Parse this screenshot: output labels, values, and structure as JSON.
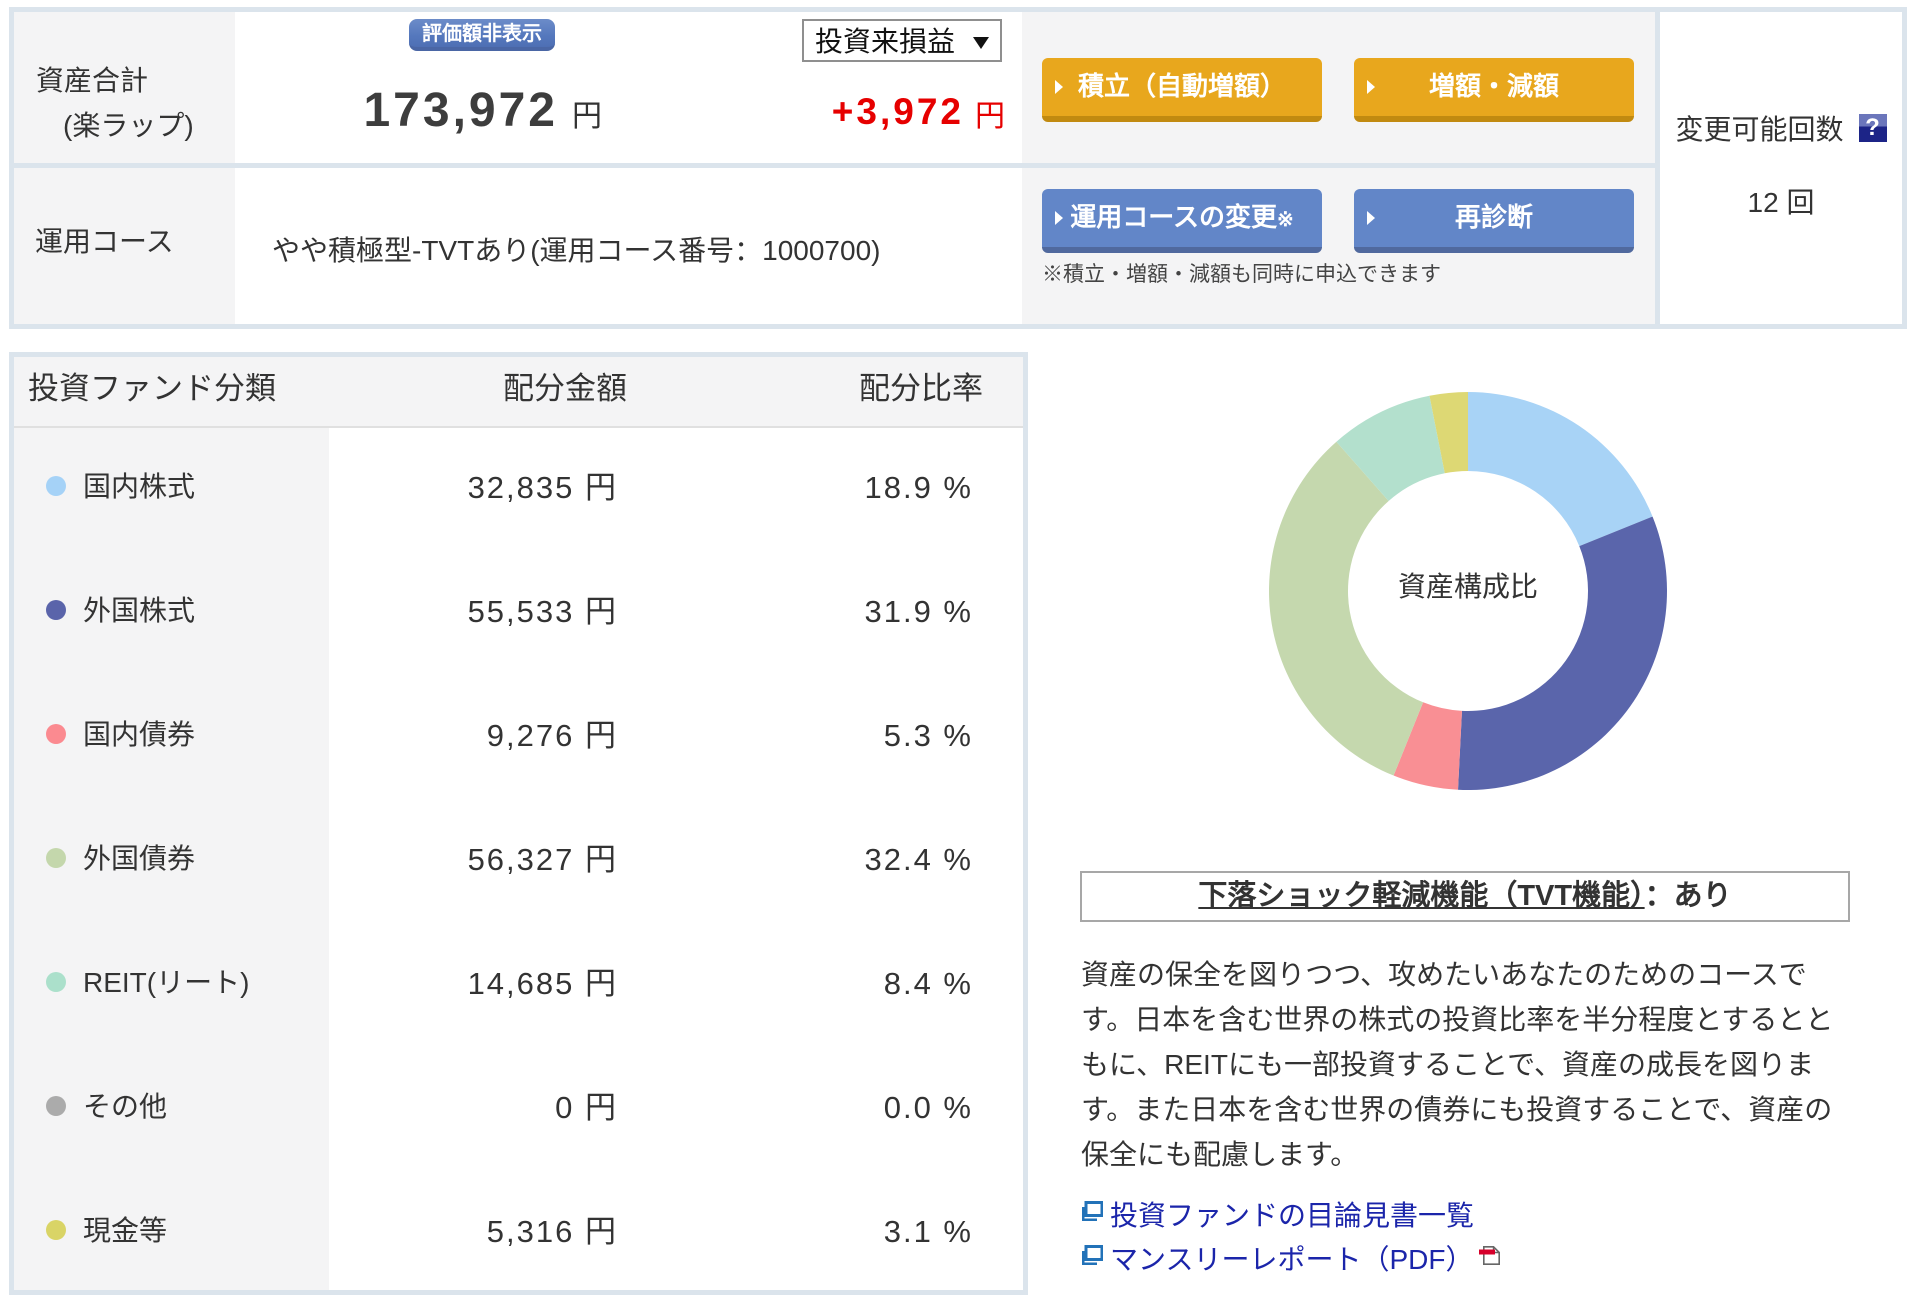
{
  "summary": {
    "asset_total_label_line1": "資産合計",
    "asset_total_label_line2": "(楽ラップ)",
    "hide_value_button": "評価額非表示",
    "total_amount": "173,972",
    "total_amount_unit": "円",
    "profit_select_value": "投資来損益",
    "profit_amount": "+3,972",
    "profit_unit": "円",
    "reserve_button": "積立（自動増額）",
    "increase_button": "増額・減額",
    "course_label": "運用コース",
    "course_value": "やや積極型-TVTあり(運用コース番号：1000700)",
    "course_change_button": "運用コースの変更",
    "course_change_button_mark": "※",
    "rediagnosis_button": "再診断",
    "course_note": "※積立・増額・減額も同時に申込できます",
    "change_count_label": "変更可能回数",
    "change_count_value": "12 回",
    "help_icon_glyph": "?"
  },
  "allocation_table": {
    "headers": [
      "投資ファンド分類",
      "配分金額",
      "配分比率"
    ],
    "rows": [
      {
        "label": "国内株式",
        "color": "#a5d2f7",
        "amount": "32,835 円",
        "ratio": "18.9 %"
      },
      {
        "label": "外国株式",
        "color": "#5a64aa",
        "amount": "55,533 円",
        "ratio": "31.9 %"
      },
      {
        "label": "国内債券",
        "color": "#fb8a90",
        "amount": "9,276 円",
        "ratio": "5.3 %"
      },
      {
        "label": "外国債券",
        "color": "#c4d7ac",
        "amount": "56,327 円",
        "ratio": "32.4 %"
      },
      {
        "label": "REIT(リート)",
        "color": "#abe0cb",
        "amount": "14,685 円",
        "ratio": "8.4 %"
      },
      {
        "label": "その他",
        "color": "#ababab",
        "amount": "0 円",
        "ratio": "0.0 %"
      },
      {
        "label": "現金等",
        "color": "#d9d466",
        "amount": "5,316 円",
        "ratio": "3.1 %"
      }
    ]
  },
  "chart_data": {
    "type": "pie",
    "subtype": "donut",
    "center_label": "資産構成比",
    "categories": [
      "国内株式",
      "外国株式",
      "国内債券",
      "外国債券",
      "REIT(リート)",
      "その他",
      "現金等"
    ],
    "values": [
      18.9,
      31.9,
      5.3,
      32.4,
      8.4,
      0.0,
      3.1
    ],
    "amounts_yen": [
      32835,
      55533,
      9276,
      56327,
      14685,
      0,
      5316
    ],
    "colors": [
      "#a8d3f6",
      "#5a65ab",
      "#f98f94",
      "#c5d8ae",
      "#b3e0cd",
      "#ababab",
      "#ddd874"
    ],
    "start_angle_deg": 0,
    "direction": "clockwise",
    "outer_radius": 200,
    "inner_radius": 120,
    "legend_position": "none"
  },
  "tvt": {
    "title_linked": "下落ショック軽減機能（TVT機能）",
    "title_suffix": "：あり"
  },
  "description_lines": [
    "資産の保全を図りつつ、攻めたいあなたのためのコースで",
    "す。日本を含む世界の株式の投資比率を半分程度とするとと",
    "もに、REITにも一部投資することで、資産の成長を図りま",
    "す。また日本を含む世界の債券にも投資することで、資産の",
    "保全にも配慮します。"
  ],
  "links": {
    "prospectus": "投資ファンドの目論見書一覧",
    "monthly_report": "マンスリーレポート（PDF）"
  }
}
